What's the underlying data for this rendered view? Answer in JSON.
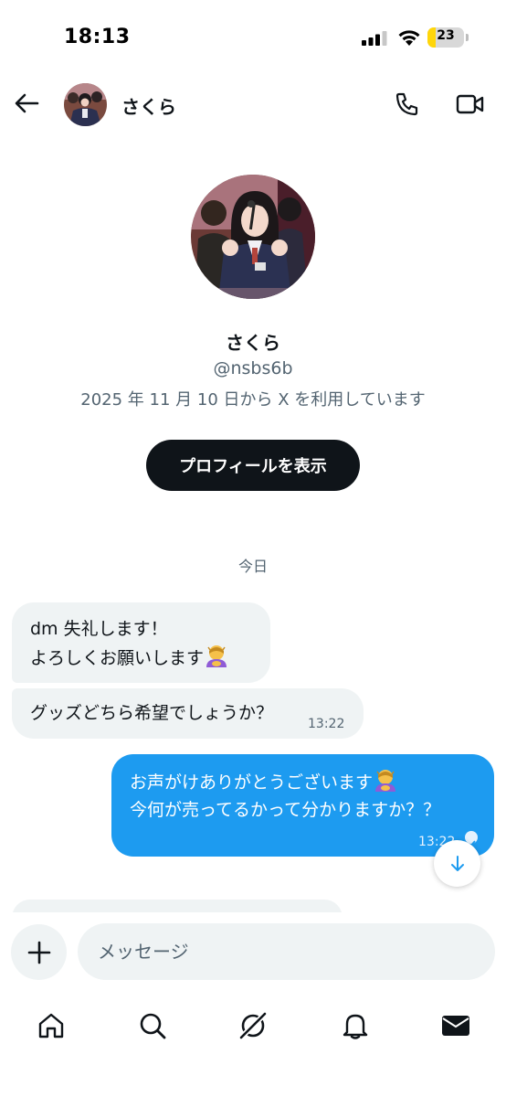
{
  "status_bar": {
    "time": "18:13",
    "battery_level": "23",
    "battery_fraction": 0.23
  },
  "header": {
    "contact_name": "さくら"
  },
  "profile": {
    "name": "さくら",
    "handle": "@nsbs6b",
    "joined": "2025 年 11 月 10 日から X を利用しています",
    "view_profile_label": "プロフィールを表示"
  },
  "date_divider": "今日",
  "messages": [
    {
      "direction": "in",
      "lines": [
        "dm 失礼します！",
        "よろしくお願いします"
      ],
      "emoji": "person-bowing-emoji"
    },
    {
      "direction": "in",
      "text": "グッズどちら希望でしょうか？",
      "time": "13:22"
    },
    {
      "direction": "out",
      "lines": [
        "お声がけありがとうございます",
        "今何が売ってるかって分かりますか？？"
      ],
      "emoji": "person-bowing-emoji",
      "time": "13:22",
      "status": "read"
    }
  ],
  "composer": {
    "placeholder": "メッセージ"
  },
  "nav": {
    "items": [
      {
        "icon": "home-icon"
      },
      {
        "icon": "search-icon"
      },
      {
        "icon": "grok-icon"
      },
      {
        "icon": "bell-icon"
      },
      {
        "icon": "mail-icon"
      }
    ]
  },
  "colors": {
    "accent": "#1d9bf0",
    "incoming_bubble": "#eff3f4",
    "dark_button": "#0f1419",
    "secondary_text": "#536471",
    "battery_low": "#ffd60a"
  }
}
